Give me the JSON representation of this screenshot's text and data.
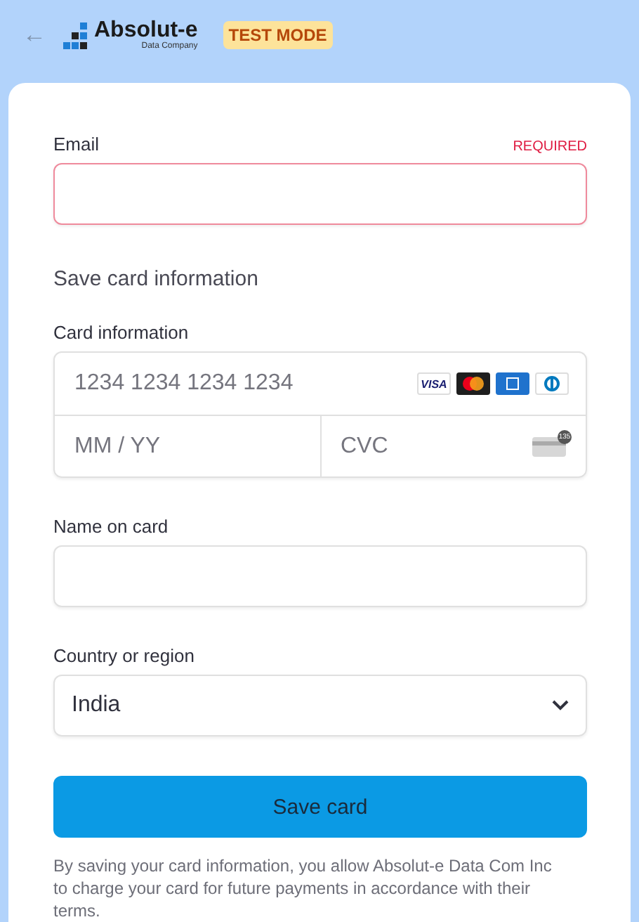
{
  "header": {
    "back": "←",
    "logo_name": "Absolut-e",
    "logo_tagline": "Data Company",
    "badge": "TEST MODE"
  },
  "email": {
    "label": "Email",
    "required": "REQUIRED",
    "invalid": true
  },
  "section_title": "Save card information",
  "card": {
    "label": "Card information",
    "number_placeholder": "1234 1234 1234 1234",
    "brands": [
      {
        "kind": "visa",
        "text": "VISA"
      },
      {
        "kind": "mastercard"
      },
      {
        "kind": "amex"
      },
      {
        "kind": "diners"
      }
    ],
    "expiry_placeholder": "MM / YY",
    "cvc_placeholder": "CVC",
    "cvc_hint": "135"
  },
  "name": {
    "label": "Name on card"
  },
  "country": {
    "label": "Country or region",
    "value": "India"
  },
  "button": "Save card",
  "terms": "By saving your card information, you allow Absolut-e Data Com Inc to charge your card for future payments in accordance with their terms."
}
